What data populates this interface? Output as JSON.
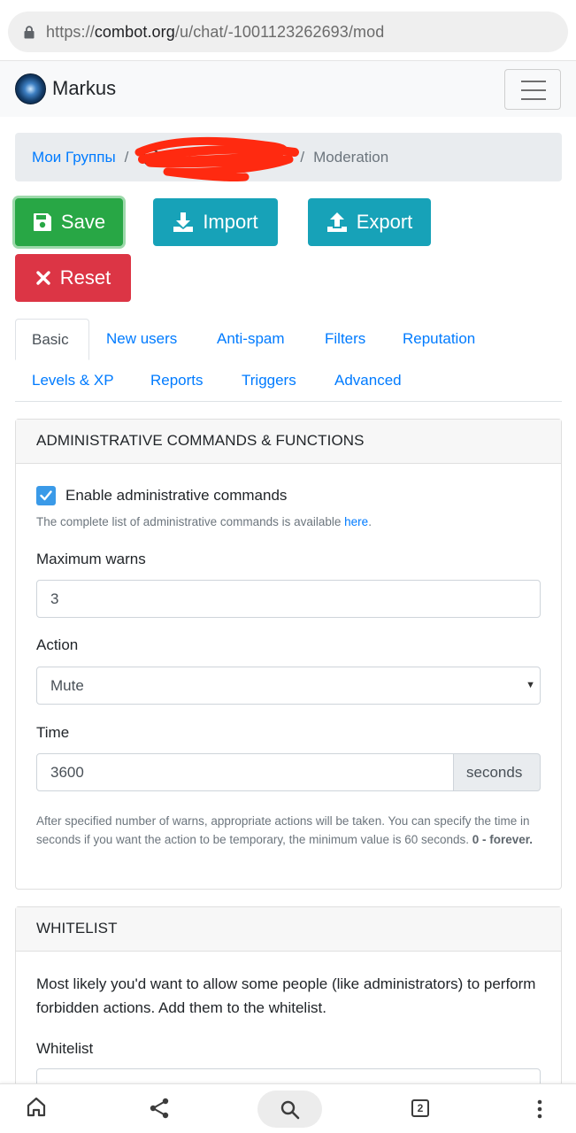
{
  "browser": {
    "url_scheme": "https://",
    "url_host": "combot.org",
    "url_path": "/u/chat/-1001123262693/mod",
    "tab_count": "2",
    "icons": [
      "lock-icon",
      "home-icon",
      "share-icon",
      "search-icon",
      "tabs-icon",
      "more-icon"
    ]
  },
  "navbar": {
    "brand": "Markus"
  },
  "breadcrumb": {
    "groups": "Мои Группы",
    "separator": "/",
    "active": "Moderation"
  },
  "buttons": {
    "save": "Save",
    "import": "Import",
    "export": "Export",
    "reset": "Reset"
  },
  "tabs": [
    "Basic",
    "New users",
    "Anti-spam",
    "Filters",
    "Reputation",
    "Levels & XP",
    "Reports",
    "Triggers",
    "Advanced"
  ],
  "admin_card": {
    "title": "ADMINISTRATIVE COMMANDS & FUNCTIONS",
    "enable_label": "Enable administrative commands",
    "enable_checked": true,
    "help_prefix": "The complete list of administrative commands is available ",
    "help_link": "here",
    "help_suffix": ".",
    "max_warns_label": "Maximum warns",
    "max_warns_value": "3",
    "action_label": "Action",
    "action_value": "Mute",
    "time_label": "Time",
    "time_value": "3600",
    "time_unit": "seconds",
    "note_text": "After specified number of warns, appropriate actions will be taken. You can specify the time in seconds if you want the action to be temporary, the minimum value is 60 seconds. ",
    "note_bold": "0 - forever."
  },
  "whitelist_card": {
    "title": "WHITELIST",
    "description": "Most likely you'd want to allow some people (like administrators) to perform forbidden actions. Add them to the whitelist.",
    "field_label": "Whitelist"
  },
  "colors": {
    "primary": "#007bff",
    "success": "#28a745",
    "info": "#17a2b8",
    "danger": "#dc3545",
    "checkbox": "#3a9ae8",
    "redaction": "#ff2a10"
  }
}
